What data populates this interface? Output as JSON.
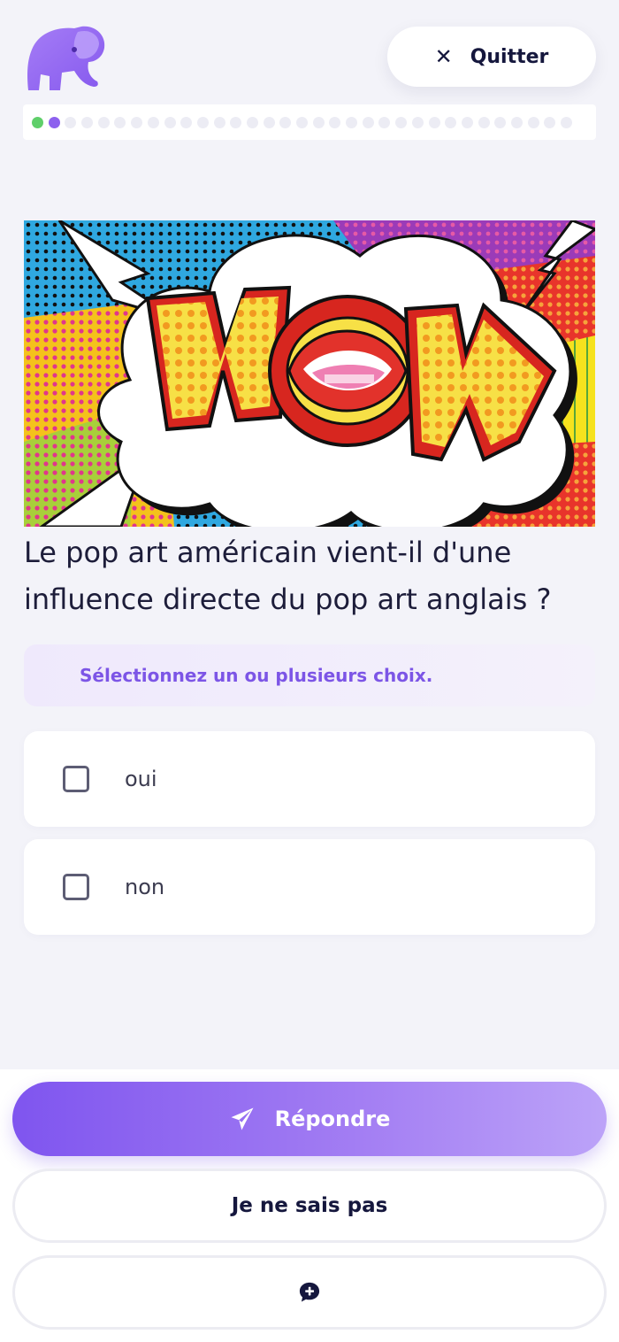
{
  "header": {
    "quit_label": "Quitter",
    "progress": {
      "total": 33,
      "completed": 1,
      "current_index": 2
    }
  },
  "question": {
    "text": "Le pop art américain vient-il d'une influence directe du pop art anglais ?",
    "hint": "Sélectionnez un ou plusieurs choix.",
    "options": [
      {
        "label": "oui",
        "checked": false
      },
      {
        "label": "non",
        "checked": false
      }
    ]
  },
  "footer": {
    "answer_label": "Répondre",
    "dont_know_label": "Je ne sais pas"
  },
  "icons": {
    "logo": "elephant-logo",
    "quit": "close-icon",
    "answer": "paper-plane-icon",
    "comment": "comment-add-icon"
  },
  "colors": {
    "accent": "#8d61ee",
    "accent_light": "#bca3f8",
    "progress_done": "#5fcf6a",
    "text_dark": "#15173d",
    "background": "#f3f3f9"
  }
}
